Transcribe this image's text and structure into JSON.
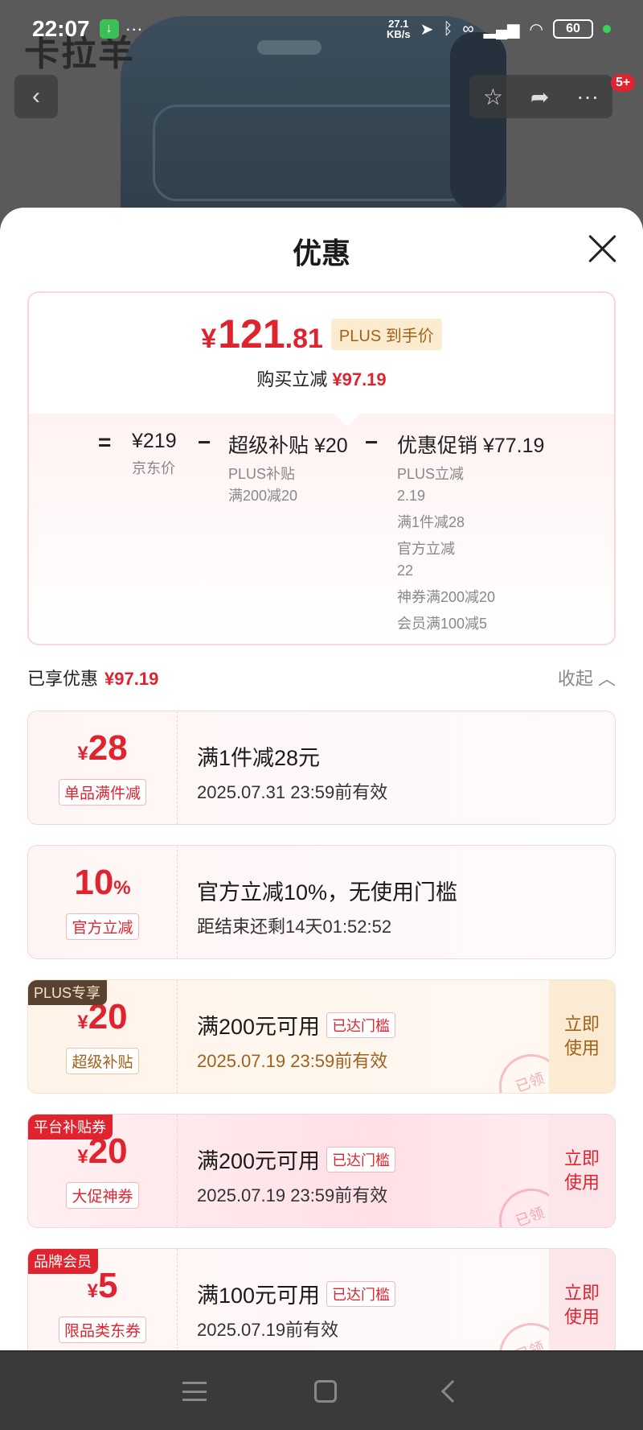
{
  "status_bar": {
    "time": "22:07",
    "speed_value": "27.1",
    "speed_unit": "KB/s",
    "battery": "60"
  },
  "header": {
    "brand": "卡拉羊",
    "badge": "5+"
  },
  "sheet": {
    "title": "优惠",
    "summary": {
      "price_yen": "¥",
      "price_int": "121",
      "price_dec": ".81",
      "plus_tag": "PLUS 到手价",
      "reduce_label": "购买立减",
      "reduce_amount": "¥97.19",
      "eq": "=",
      "jd_price": "¥219",
      "jd_label": "京东价",
      "minus1": "−",
      "subsidy_title": "超级补贴 ¥20",
      "subsidy_lines": [
        "PLUS补贴",
        "满200减20"
      ],
      "minus2": "−",
      "promo_title": "优惠促销 ¥77.19",
      "promo_lines": [
        "PLUS立减",
        "2.19",
        "满1件减28",
        "官方立减",
        "22",
        "神券满200减20",
        "会员满100减5"
      ]
    },
    "enjoyed_label": "已享优惠",
    "enjoyed_amount": "¥97.19",
    "collapse_label": "收起 ︿",
    "coupons": [
      {
        "yen": "¥",
        "amount": "28",
        "tag": "单品满件减",
        "line1": "满1件减28元",
        "line2": "2025.07.31 23:59前有效"
      },
      {
        "amount": "10",
        "pct": "%",
        "tag": "官方立减",
        "line1": "官方立减10%，无使用门槛",
        "line2": "距结束还剩14天01:52:52"
      },
      {
        "corner": "PLUS专享",
        "yen": "¥",
        "amount": "20",
        "tag": "超级补贴",
        "line1": "满200元可用",
        "threshold": "已达门槛",
        "line2": "2025.07.19 23:59前有效",
        "use": "立即使用",
        "stamp": "已领"
      },
      {
        "corner": "平台补贴券",
        "yen": "¥",
        "amount": "20",
        "tag": "大促神券",
        "line1": "满200元可用",
        "threshold": "已达门槛",
        "line2": "2025.07.19 23:59前有效",
        "use": "立即使用",
        "stamp": "已领"
      },
      {
        "corner": "品牌会员",
        "yen": "¥",
        "amount": "5",
        "tag": "限品类东券",
        "line1": "满100元可用",
        "threshold": "已达门槛",
        "line2": "2025.07.19前有效",
        "use": "立即使用",
        "stamp": "已领"
      }
    ]
  },
  "colors": {
    "accent_red": "#e0242f",
    "plus_gold": "#a0621a"
  }
}
